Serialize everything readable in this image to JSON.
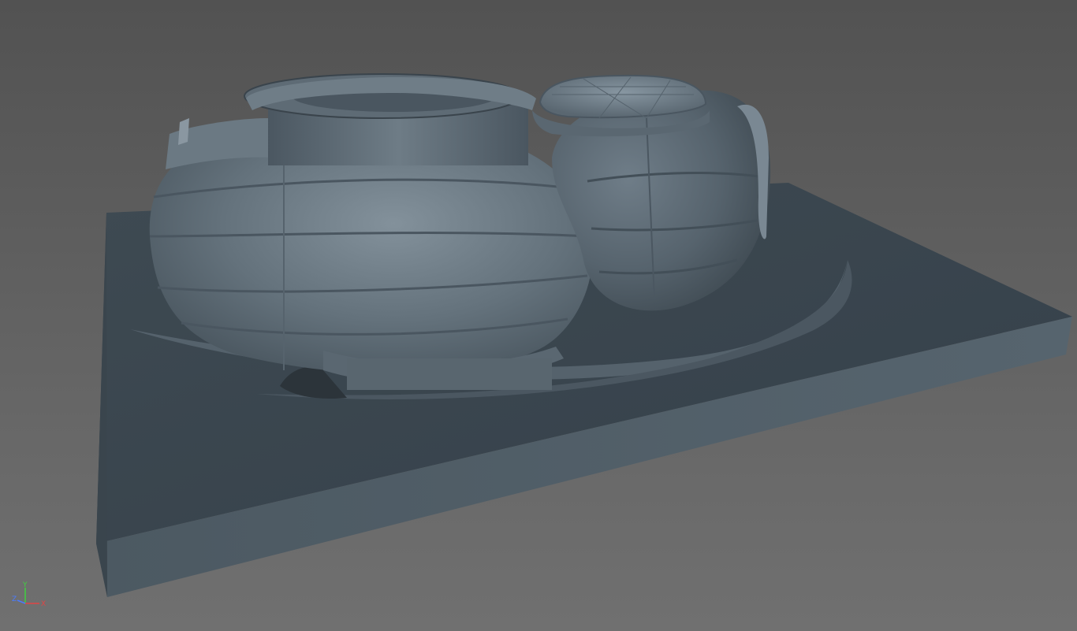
{
  "viewport": {
    "background_top": "#525252",
    "background_bottom": "#707070",
    "model": {
      "base_top_color": "#3b454c",
      "base_front_color": "#46525a",
      "base_side_color": "#3f4a52",
      "shell_color": "#5e6c77",
      "shell_highlight": "#7f8d97",
      "shell_shadow": "#3a444c",
      "dome_color": "#6c7a85"
    }
  },
  "axis_gizmo": {
    "y_label": "Y",
    "z_label": "Z",
    "x_label": "X",
    "y_color": "#3fd03f",
    "z_color": "#4a7bff",
    "x_color": "#e04545"
  }
}
